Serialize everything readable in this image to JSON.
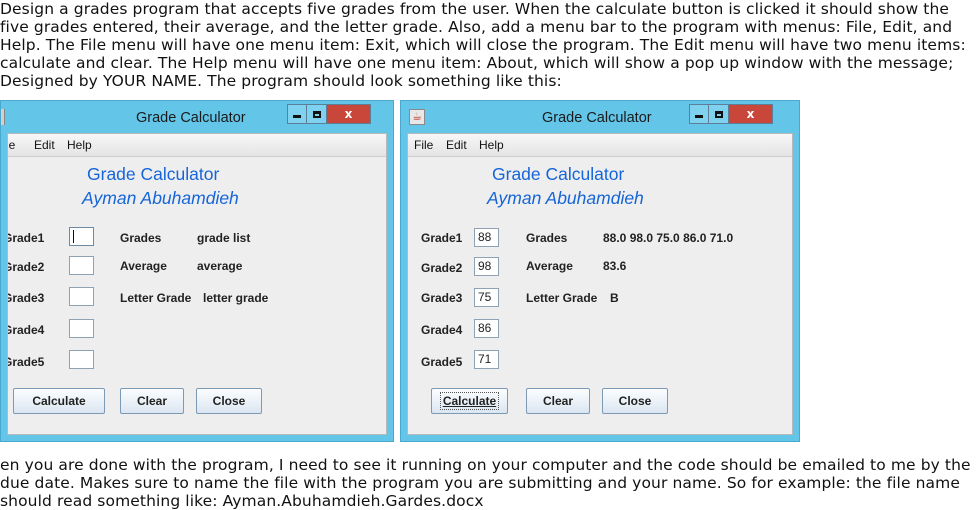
{
  "instructions_top": {
    "lines": [
      "Design a grades program that accepts five grades from the user. When the calculate button is clicked it should show the",
      "five grades entered, their average, and the letter grade. Also, add a menu bar to the program with menus: File, Edit, and",
      "Help. The File menu will have one menu item: Exit, which will close the program. The Edit menu will have two menu items:",
      "calculate and clear. The Help menu will have one menu item: About, which will show a pop up window with the message;",
      "Designed by YOUR NAME. The program should look something like this:"
    ]
  },
  "instructions_bottom": {
    "lines": [
      "en you are done with the program, I need to see it running on your computer and the code should be emailed to me by the",
      "due date. Makes sure to name the file with the program you are submitting and your name. So for example: the file name",
      "should read something like: Ayman.Abuhamdieh.Gardes.docx"
    ]
  },
  "window_left": {
    "title": "Grade Calculator",
    "close_glyph": "x",
    "menus": [
      "le",
      "Edit",
      "Help"
    ],
    "heading": "Grade Calculator",
    "subheading": "Ayman Abuhamdieh",
    "grade_labels": [
      "Grade1",
      "Grade2",
      "Grade3",
      "Grade4",
      "Grade5"
    ],
    "grade_values": [
      "",
      "",
      "",
      "",
      ""
    ],
    "result_labels": [
      "Grades",
      "Average",
      "Letter Grade"
    ],
    "result_values": [
      "grade list",
      "average",
      "letter grade"
    ],
    "buttons": [
      "Calculate",
      "Clear",
      "Close"
    ]
  },
  "window_right": {
    "title": "Grade Calculator",
    "close_glyph": "x",
    "menus": [
      "File",
      "Edit",
      "Help"
    ],
    "heading": "Grade Calculator",
    "subheading": "Ayman Abuhamdieh",
    "grade_labels": [
      "Grade1",
      "Grade2",
      "Grade3",
      "Grade4",
      "Grade5"
    ],
    "grade_values": [
      "88",
      "98",
      "75",
      "86",
      "71"
    ],
    "result_labels": [
      "Grades",
      "Average",
      "Letter Grade"
    ],
    "result_values": [
      "88.0 98.0 75.0 86.0 71.0",
      "83.6",
      "B"
    ],
    "buttons": [
      "Calculate",
      "Clear",
      "Close"
    ]
  },
  "colors": {
    "window_frame": "#63c6e9",
    "close_button": "#c9473a",
    "heading_text": "#1565d8"
  },
  "icons": [
    "java-cup-icon",
    "minimize-icon",
    "maximize-icon",
    "close-icon"
  ]
}
